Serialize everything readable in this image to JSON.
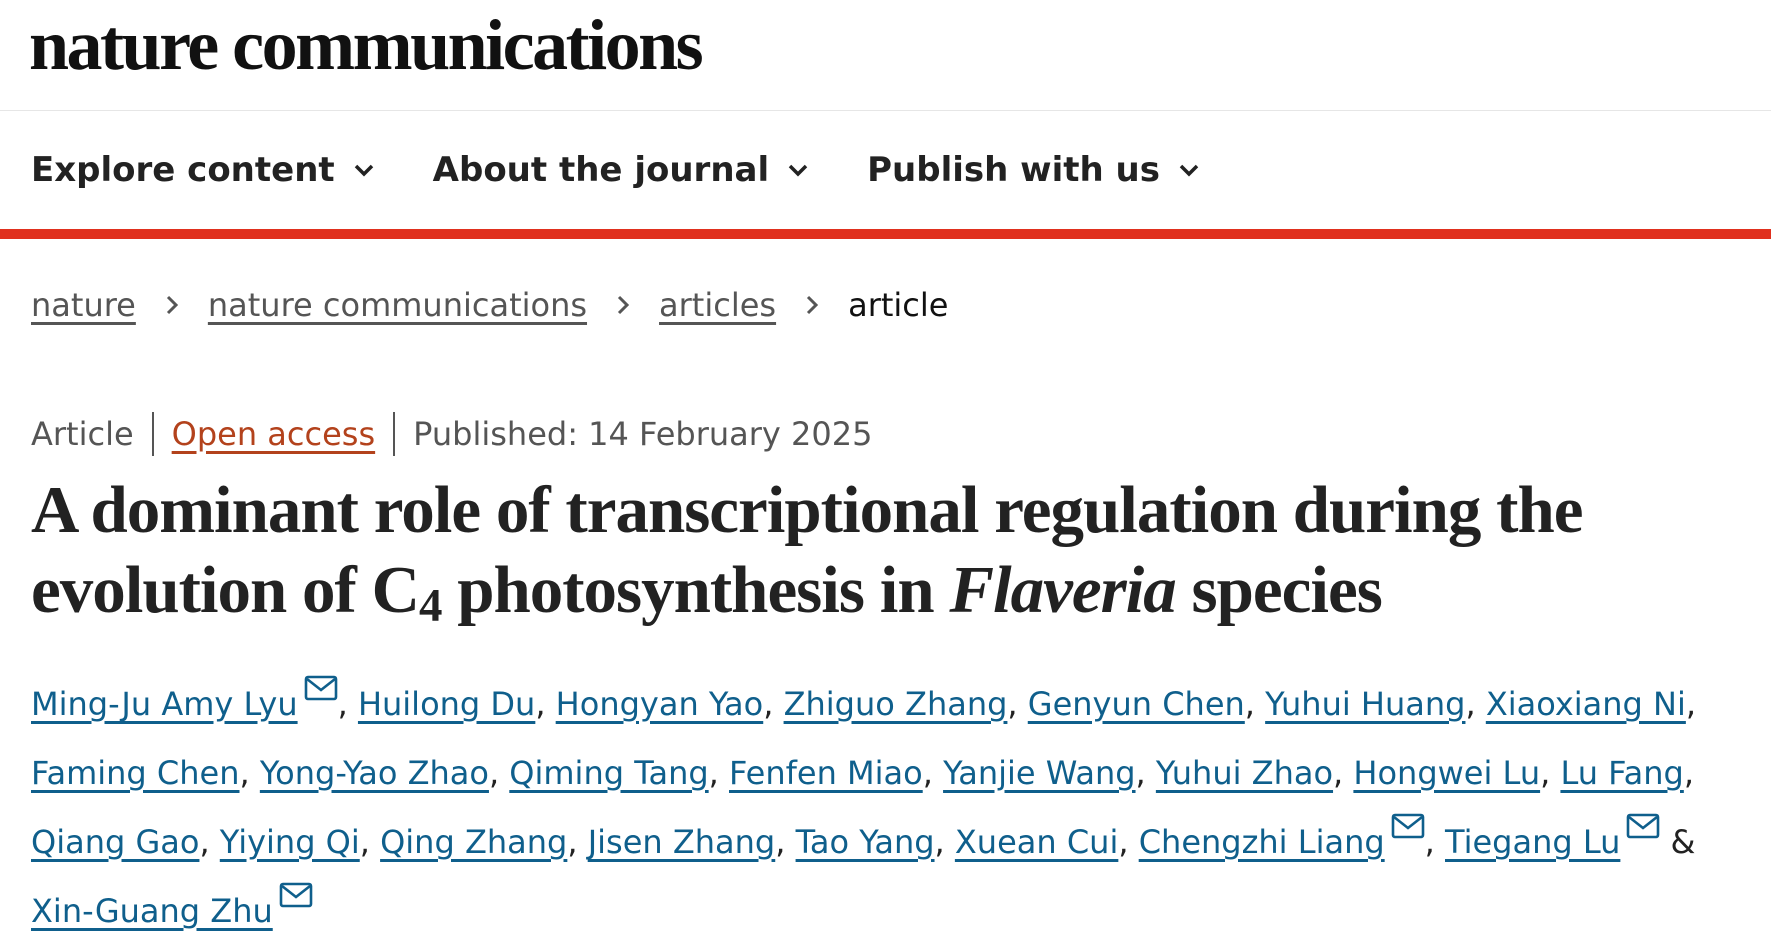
{
  "header": {
    "logo": "nature communications"
  },
  "nav": {
    "items": [
      {
        "label": "Explore content"
      },
      {
        "label": "About the journal"
      },
      {
        "label": "Publish with us"
      }
    ]
  },
  "breadcrumb": {
    "items": [
      "nature",
      "nature communications",
      "articles"
    ],
    "current": "article"
  },
  "article": {
    "type": "Article",
    "access": "Open access",
    "published": "Published: 14 February 2025",
    "title_part1": "A dominant role of transcriptional regulation during the evolution of C",
    "title_sub": "4",
    "title_part2": " photosynthesis in ",
    "title_italic": "Flaveria",
    "title_part3": " species"
  },
  "authors": [
    {
      "name": "Ming-Ju Amy Lyu",
      "corresponding": true
    },
    {
      "name": "Huilong Du"
    },
    {
      "name": "Hongyan Yao"
    },
    {
      "name": "Zhiguo Zhang"
    },
    {
      "name": "Genyun Chen"
    },
    {
      "name": "Yuhui Huang"
    },
    {
      "name": "Xiaoxiang Ni"
    },
    {
      "name": "Faming Chen"
    },
    {
      "name": "Yong-Yao Zhao"
    },
    {
      "name": "Qiming Tang"
    },
    {
      "name": "Fenfen Miao"
    },
    {
      "name": "Yanjie Wang"
    },
    {
      "name": "Yuhui Zhao"
    },
    {
      "name": "Hongwei Lu"
    },
    {
      "name": "Lu Fang"
    },
    {
      "name": "Qiang Gao"
    },
    {
      "name": "Yiying Qi"
    },
    {
      "name": "Qing Zhang"
    },
    {
      "name": "Jisen Zhang"
    },
    {
      "name": "Tao Yang"
    },
    {
      "name": "Xuean Cui"
    },
    {
      "name": "Chengzhi Liang",
      "corresponding": true
    },
    {
      "name": "Tiegang Lu",
      "corresponding": true
    },
    {
      "name": "Xin-Guang Zhu",
      "corresponding": true
    }
  ],
  "author_separator": ",",
  "author_conjunction": "&",
  "icons": {
    "nav_chevron": "chevron-down-icon",
    "breadcrumb_separator": "chevron-right-icon",
    "corresponding": "mail-icon"
  },
  "colors": {
    "accent_rule": "#e0301e",
    "author_link": "#0f5f8c",
    "open_access": "#b3421c"
  }
}
